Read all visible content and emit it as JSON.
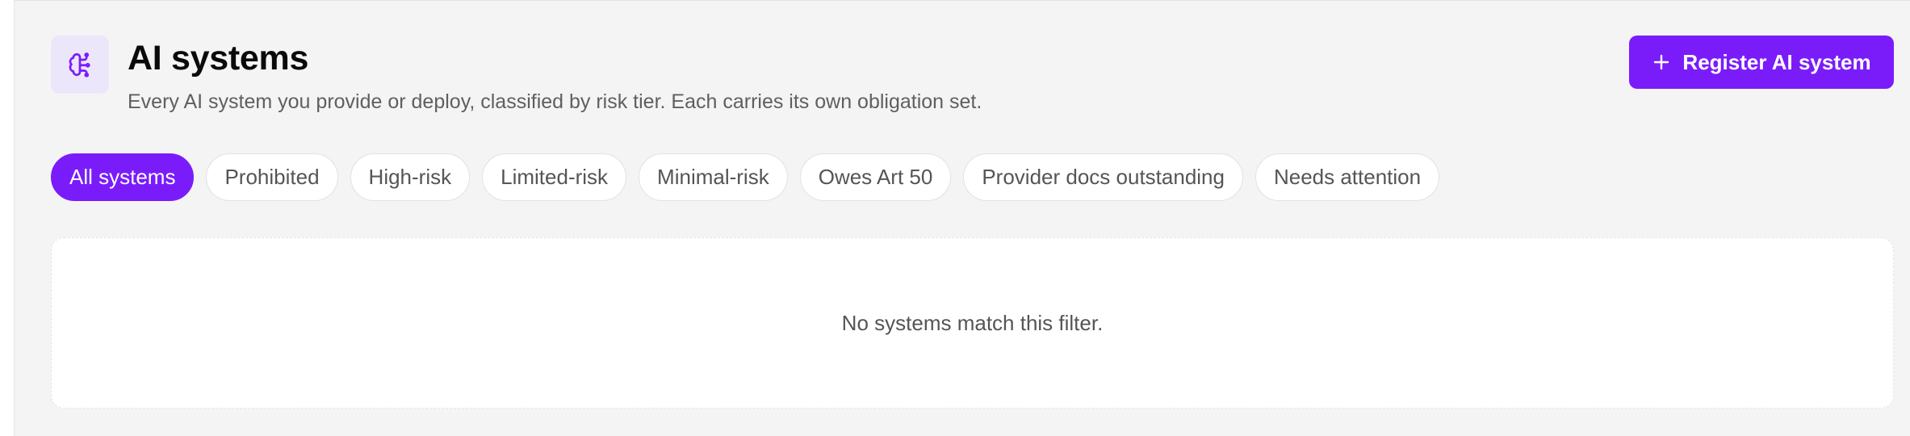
{
  "header": {
    "icon": "brain-icon",
    "title": "AI systems",
    "subtitle": "Every AI system you provide or deploy, classified by risk tier. Each carries its own obligation set.",
    "register_button": {
      "icon": "plus-icon",
      "label": "Register AI system"
    }
  },
  "filters": {
    "active_index": 0,
    "items": [
      {
        "label": "All systems"
      },
      {
        "label": "Prohibited"
      },
      {
        "label": "High-risk"
      },
      {
        "label": "Limited-risk"
      },
      {
        "label": "Minimal-risk"
      },
      {
        "label": "Owes Art 50"
      },
      {
        "label": "Provider docs outstanding"
      },
      {
        "label": "Needs attention"
      }
    ]
  },
  "empty_state": {
    "message": "No systems match this filter."
  },
  "colors": {
    "accent": "#7a1cfa",
    "icon_bg": "#ece6fb",
    "page_bg": "#f4f4f4"
  }
}
